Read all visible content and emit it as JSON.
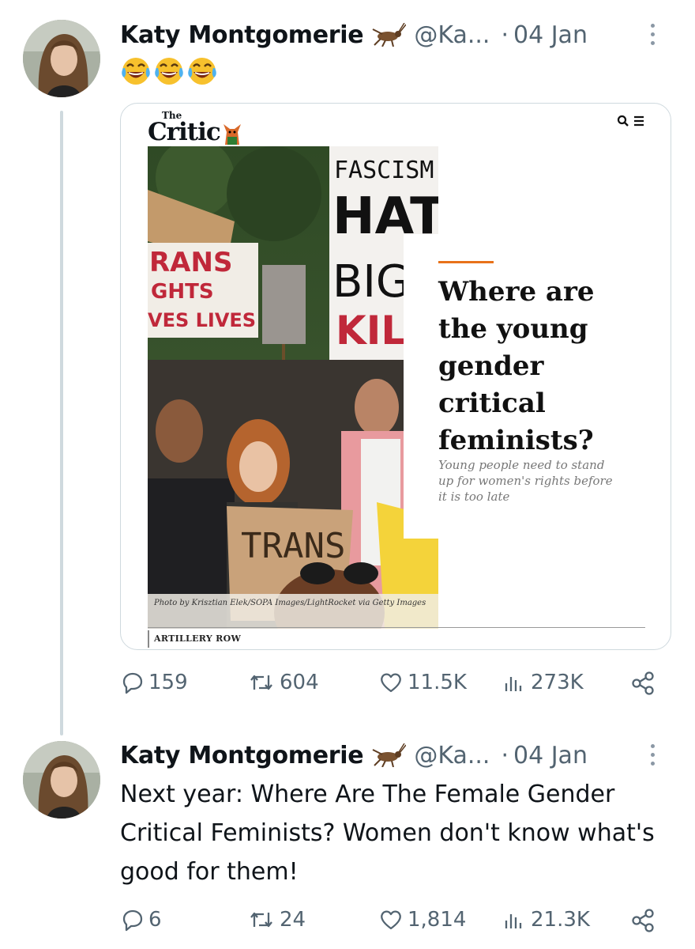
{
  "tweets": [
    {
      "author_name": "Katy Montgomerie",
      "handle": "@Ka...",
      "separator": "·",
      "date": "04 Jan",
      "badge_icon": "cricket-icon",
      "emoji_icons": [
        "laughing-tears-emoji",
        "laughing-tears-emoji",
        "laughing-tears-emoji"
      ],
      "card": {
        "publication_prefix": "The",
        "publication": "Critic",
        "icons": [
          "search-icon",
          "menu-icon"
        ],
        "headline": "Where are the young gender critical feminists?",
        "subhead": "Young people need to stand up for women's rights before it is too late",
        "photo_caption": "Photo by Krisztian Elek/SOPA Images/LightRocket via Getty Images",
        "section": "ARTILLERY ROW",
        "photo_signs": [
          "FASCISM",
          "HATE",
          "BIGO",
          "KIL",
          "RANS",
          "GHTS",
          "VES LIVES",
          "TRANS"
        ]
      },
      "metrics": {
        "replies": "159",
        "reposts": "604",
        "likes": "11.5K",
        "views": "273K"
      }
    },
    {
      "author_name": "Katy Montgomerie",
      "handle": "@Ka...",
      "separator": "·",
      "date": "04 Jan",
      "badge_icon": "cricket-icon",
      "text": "Next year: Where Are The Female Gender Critical Feminists? Women don't know what's good for them!",
      "metrics": {
        "replies": "6",
        "reposts": "24",
        "likes": "1,814",
        "views": "21.3K"
      }
    }
  ],
  "colors": {
    "text": "#0f1419",
    "muted": "#536471",
    "thread": "#cfd9de",
    "accent": "#e8721a"
  }
}
